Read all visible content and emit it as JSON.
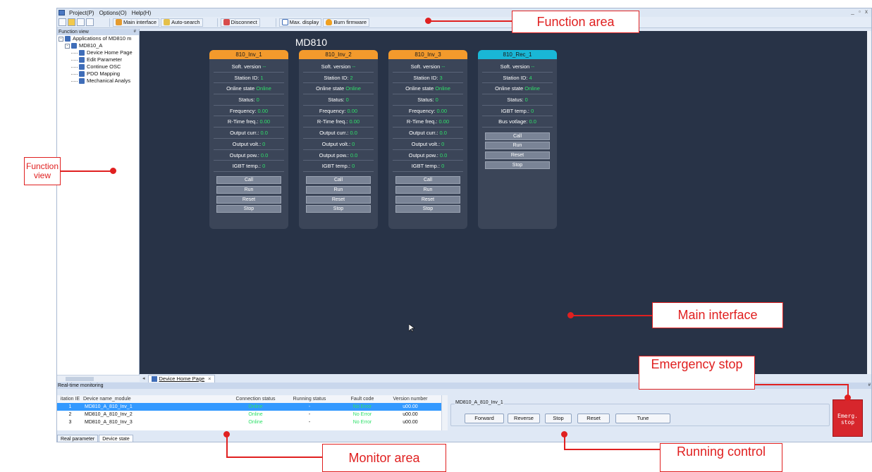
{
  "menubar": {
    "items": [
      "Project(P)",
      "Options(O)",
      "Help(H)"
    ],
    "window_controls": "_ ▫ x"
  },
  "toolbar": {
    "main_interface": "Main interface",
    "auto_search": "Auto-search",
    "disconnect": "Disconnect",
    "max_display": "Max. display",
    "burn_firmware": "Burn firmware"
  },
  "function_view": {
    "title": "Function view",
    "pin": "#",
    "tree": [
      {
        "label": "Applications of MD810 m",
        "level": 0,
        "expander": "-"
      },
      {
        "label": "MD810_A",
        "level": 1,
        "expander": "-"
      },
      {
        "label": "Device Home Page",
        "level": 2
      },
      {
        "label": "Edit Parameter",
        "level": 2
      },
      {
        "label": "Continue OSC",
        "level": 2
      },
      {
        "label": "PDO Mapping",
        "level": 2
      },
      {
        "label": "Mechanical Analys",
        "level": 2
      }
    ],
    "scroll_label": "III"
  },
  "main": {
    "title": "MD810",
    "cards": [
      {
        "name": "810_Inv_1",
        "color": "#f39a2c",
        "params": [
          {
            "label": "Soft. version",
            "value": "--"
          },
          {
            "label": "Station ID:",
            "value": "1"
          },
          {
            "label": "Online state",
            "value": "Online"
          },
          {
            "label": "Status:",
            "value": "0"
          },
          {
            "label": "Frequency:",
            "value": "0.00"
          },
          {
            "label": "R-Time freq.:",
            "value": "0.00"
          },
          {
            "label": "Output curr.:",
            "value": "0.0"
          },
          {
            "label": "Output volt.:",
            "value": "0"
          },
          {
            "label": "Output pow.:",
            "value": "0.0"
          },
          {
            "label": "IGBT temp.:",
            "value": "0"
          }
        ]
      },
      {
        "name": "810_Inv_2",
        "color": "#f39a2c",
        "params": [
          {
            "label": "Soft. version",
            "value": "--"
          },
          {
            "label": "Station ID:",
            "value": "2"
          },
          {
            "label": "Online state",
            "value": "Online"
          },
          {
            "label": "Status:",
            "value": "0"
          },
          {
            "label": "Frequency:",
            "value": "0.00"
          },
          {
            "label": "R-Time freq.:",
            "value": "0.00"
          },
          {
            "label": "Output curr.:",
            "value": "0.0"
          },
          {
            "label": "Output volt.:",
            "value": "0"
          },
          {
            "label": "Output pow.:",
            "value": "0.0"
          },
          {
            "label": "IGBT temp.:",
            "value": "0"
          }
        ]
      },
      {
        "name": "810_Inv_3",
        "color": "#f39a2c",
        "params": [
          {
            "label": "Soft. version",
            "value": "--"
          },
          {
            "label": "Station ID:",
            "value": "3"
          },
          {
            "label": "Online state",
            "value": "Online"
          },
          {
            "label": "Status:",
            "value": "0"
          },
          {
            "label": "Frequency:",
            "value": "0.00"
          },
          {
            "label": "R-Time freq.:",
            "value": "0.00"
          },
          {
            "label": "Output curr.:",
            "value": "0.0"
          },
          {
            "label": "Output volt.:",
            "value": "0"
          },
          {
            "label": "Output pow.:",
            "value": "0.0"
          },
          {
            "label": "IGBT temp.:",
            "value": "0"
          }
        ]
      },
      {
        "name": "810_Rec_1",
        "color": "#19b7d6",
        "params": [
          {
            "label": "Soft. version",
            "value": "--"
          },
          {
            "label": "Station ID:",
            "value": "4"
          },
          {
            "label": "Online state",
            "value": "Online"
          },
          {
            "label": "Status:",
            "value": "0"
          },
          {
            "label": "IGBT temp.:",
            "value": "0"
          },
          {
            "label": "Bus votlage:",
            "value": "0.0"
          }
        ]
      }
    ],
    "card_buttons": [
      "Call",
      "Run",
      "Reset",
      "Stop"
    ],
    "tab": {
      "label": "Device Home Page",
      "close": "×"
    }
  },
  "monitor": {
    "title": "Real-time monitoring",
    "pin": "#",
    "headers": [
      "itation IE",
      "Device name_module",
      "Connection status",
      "Running status",
      "Fault code",
      "Version number"
    ],
    "rows": [
      [
        "1",
        "MD810_A_810_Inv_1",
        "Online",
        "-",
        "No Error",
        "u00.00"
      ],
      [
        "2",
        "MD810_A_810_Inv_2",
        "Online",
        "-",
        "No Error",
        "u00.00"
      ],
      [
        "3",
        "MD810_A_810_Inv_3",
        "Online",
        "-",
        "No Error",
        "u00.00"
      ]
    ],
    "tabs": [
      "Real parameter",
      "Device state"
    ]
  },
  "running_control": {
    "device": "MD810_A_810_Inv_1",
    "buttons": [
      "Forward",
      "Reverse",
      "Stop",
      "Reset",
      "Tune"
    ]
  },
  "emergency": {
    "line1": "Emerg.",
    "line2": "stop"
  },
  "annotations": {
    "function_area": "Function area",
    "function_view": "Function view",
    "main_interface": "Main interface",
    "emergency_stop": "Emergency stop",
    "monitor_area": "Monitor area",
    "running_control": "Running control"
  },
  "colors": {
    "accent_red": "#e02020",
    "main_bg": "#283347",
    "online_green": "#2fe06a",
    "selection_blue": "#3399ff"
  }
}
